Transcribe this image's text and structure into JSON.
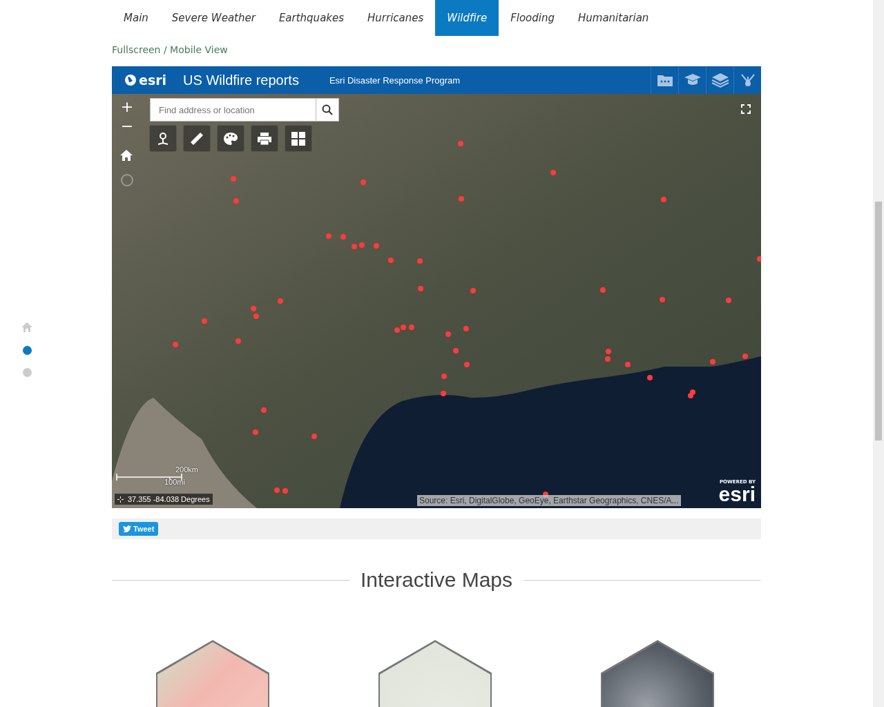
{
  "tabs": [
    {
      "label": "Main",
      "selected": false
    },
    {
      "label": "Severe Weather",
      "selected": false
    },
    {
      "label": "Earthquakes",
      "selected": false
    },
    {
      "label": "Hurricanes",
      "selected": false
    },
    {
      "label": "Wildfire",
      "selected": true
    },
    {
      "label": "Flooding",
      "selected": false
    },
    {
      "label": "Humanitarian",
      "selected": false
    }
  ],
  "view_link": "Fullscreen / Mobile View",
  "side_nav": [
    {
      "kind": "home",
      "selected": false
    },
    {
      "kind": "dot",
      "selected": true
    },
    {
      "kind": "dot",
      "selected": false
    }
  ],
  "map_app": {
    "logo": "esri",
    "title": "US Wildfire reports",
    "subtitle": "Esri Disaster Response Program",
    "zoom_in": "+",
    "zoom_out": "−",
    "search": {
      "placeholder": "Find address or location"
    },
    "scale": {
      "metric": "200km",
      "imperial": "100mi"
    },
    "coordinates": "37.355 -84.038 Degrees",
    "attribution": "Source: Esri, DigitalGlobe, GeoEye, Earthstar Geographics, CNES/A...",
    "powered_by": "POWERED BY",
    "powered_logo": "esri"
  },
  "tweet_button": "Tweet",
  "section_heading": "Interactive Maps",
  "thumbnails": [
    {
      "kind": "perimeter"
    },
    {
      "kind": "structures"
    },
    {
      "kind": "smoke"
    }
  ]
}
